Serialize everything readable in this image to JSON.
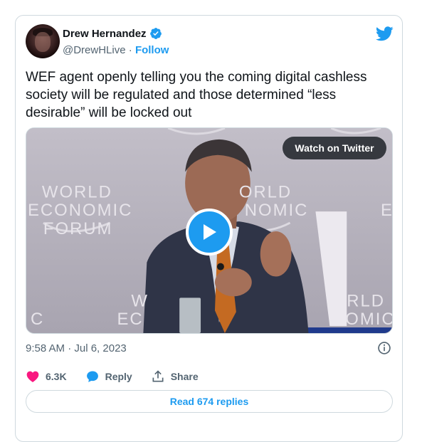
{
  "author": {
    "name": "Drew Hernandez",
    "handle": "@DrewHLive",
    "separator": "·",
    "follow_label": "Follow",
    "verified": true
  },
  "tweet": {
    "text": "WEF agent openly telling you the coming digital cashless society will be regulated and those determined “less desirable” will be locked out",
    "timestamp": "9:58 AM · Jul 6, 2023"
  },
  "media": {
    "watch_label": "Watch on Twitter",
    "backdrop_text_left": [
      "WORLD",
      "ECONOMIC",
      "FORUM"
    ],
    "backdrop_text_right": [
      "ORLD",
      "NOMIC"
    ],
    "backdrop_text_lower_left": [
      "W",
      "EC",
      "C"
    ],
    "backdrop_text_lower_right": [
      "RLD",
      "OMIC"
    ],
    "backdrop_text_edge": "E"
  },
  "actions": {
    "likes": "6.3K",
    "reply_label": "Reply",
    "share_label": "Share"
  },
  "read_replies_label": "Read 674 replies",
  "colors": {
    "accent": "#1d9bf0",
    "like": "#f91880",
    "muted": "#536471",
    "border": "#cfd9de"
  },
  "icons": {
    "verified": "verified-badge-icon",
    "logo": "twitter-bird-icon",
    "play": "play-icon",
    "info": "info-icon",
    "like": "heart-icon",
    "reply": "reply-bubble-icon",
    "share": "share-upload-icon"
  }
}
